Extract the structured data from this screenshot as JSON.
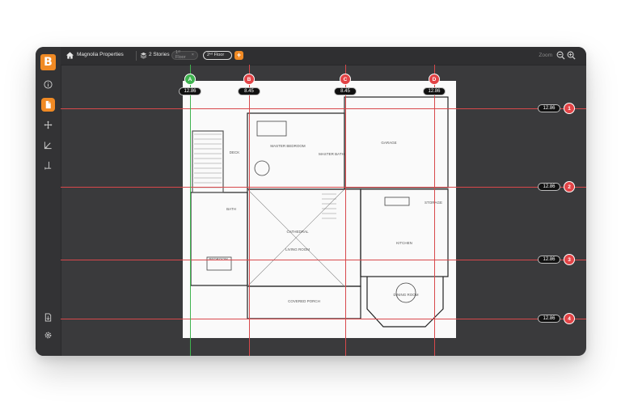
{
  "app": {
    "logo_letter": "B",
    "accent": "#f08a24"
  },
  "topbar": {
    "project_name": "Magnolia Properties",
    "stories_label": "2 Stories",
    "floor_1_label": "1ˢᵗ Floor",
    "floor_1_close": "×",
    "floor_2_label": "2ⁿᵈ Floor",
    "add_label": "+",
    "zoom_label": "Zoom"
  },
  "sidebar": {
    "items": [
      {
        "icon": "info-icon"
      },
      {
        "icon": "document-icon",
        "active": true
      },
      {
        "icon": "move-icon"
      },
      {
        "icon": "angle-icon"
      },
      {
        "icon": "measure-icon"
      }
    ],
    "bottom_items": [
      {
        "icon": "export-icon"
      },
      {
        "icon": "settings-icon"
      }
    ]
  },
  "grid": {
    "columns": [
      {
        "label": "A",
        "value": "12.86",
        "color": "#3fb34f"
      },
      {
        "label": "B",
        "value": "8.45",
        "color": "#e24346"
      },
      {
        "label": "C",
        "value": "8.45",
        "color": "#e24346"
      },
      {
        "label": "D",
        "value": "12.86",
        "color": "#e24346"
      }
    ],
    "rows": [
      {
        "label": "1",
        "value": "12.86"
      },
      {
        "label": "2",
        "value": "12.86"
      },
      {
        "label": "3",
        "value": "12.86"
      },
      {
        "label": "4",
        "value": "12.86"
      }
    ]
  },
  "plan_labels": {
    "deck": "DECK",
    "master_bedroom": "MASTER BEDROOM",
    "master_bath": "MASTER BATH",
    "garage": "GARAGE",
    "bath": "BATH",
    "storage": "STORAGE",
    "cathedral": "CATHEDRAL",
    "living_room": "LIVING ROOM",
    "kitchen": "KITCHEN",
    "bedroom": "BEDROOM",
    "covered_porch": "COVERED PORCH",
    "dining_room": "DINING ROOM"
  }
}
